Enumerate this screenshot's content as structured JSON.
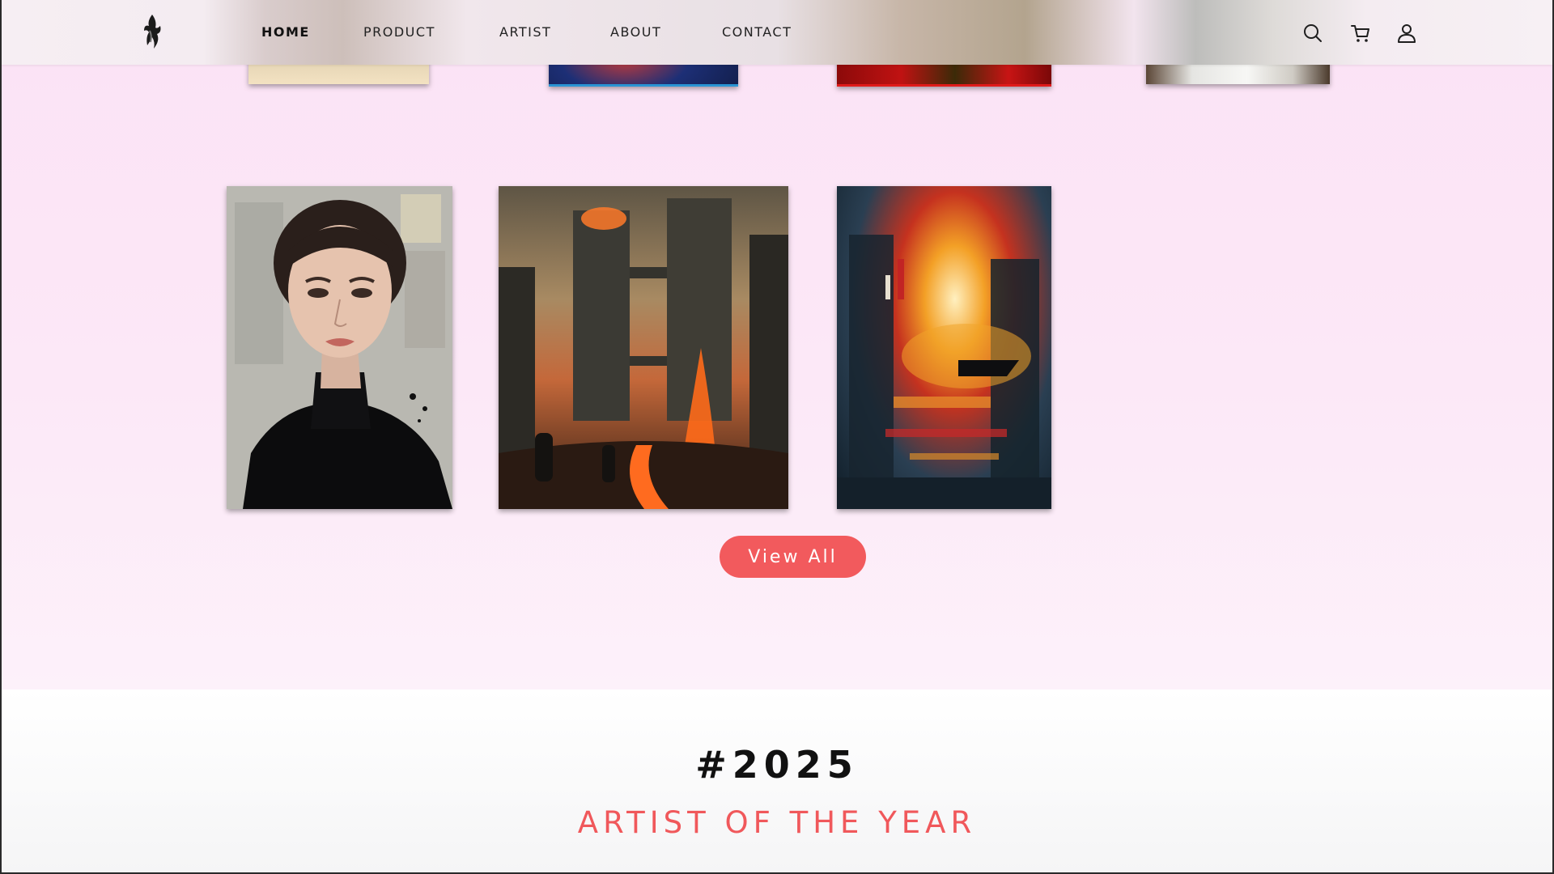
{
  "header": {
    "nav": [
      {
        "label": "HOME",
        "active": true
      },
      {
        "label": "PRODUCT",
        "active": false
      },
      {
        "label": "ARTIST",
        "active": false
      },
      {
        "label": "ABOUT",
        "active": false
      },
      {
        "label": "CONTACT",
        "active": false
      }
    ],
    "icons": [
      "search-icon",
      "cart-icon",
      "user-icon"
    ]
  },
  "gallery": {
    "top_row": [
      "artwork-sepia",
      "artwork-blue-red",
      "artwork-red",
      "artwork-white-fur"
    ],
    "main_row": [
      "portrait-woman-black-turtleneck",
      "burning-city-towers",
      "abstract-city-sunset"
    ],
    "view_all_label": "View All"
  },
  "artist_of_year": {
    "year": "#2025",
    "subtitle": "ARTIST OF THE YEAR"
  },
  "colors": {
    "accent": "#f25a5d",
    "gallery_bg": "#fce8f7",
    "heading": "#111111"
  }
}
